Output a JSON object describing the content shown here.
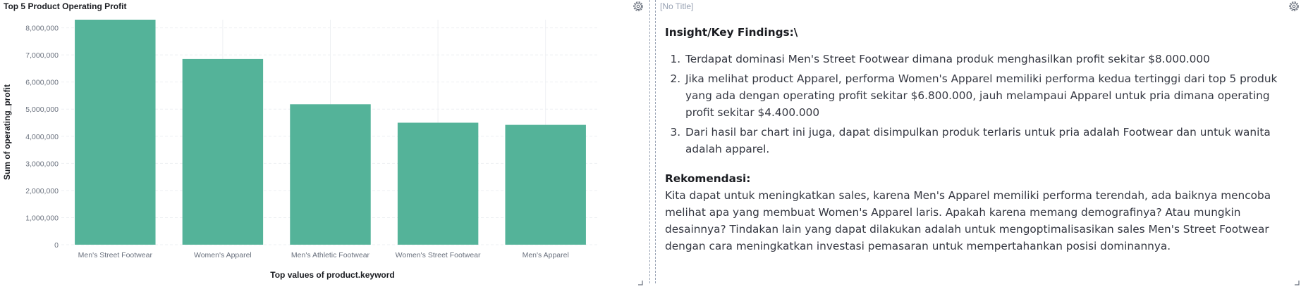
{
  "left_panel": {
    "title": "Top 5 Product Operating Profit"
  },
  "right_panel": {
    "title": "[No Title]",
    "heading": "Insight/Key Findings:\\",
    "findings": [
      "Terdapat dominasi Men's Street Footwear dimana produk menghasilkan profit sekitar $8.000.000",
      "Jika melihat product Apparel, performa Women's Apparel memiliki performa kedua tertinggi dari top 5 produk yang ada dengan operating profit sekitar $6.800.000, jauh melampaui Apparel untuk pria dimana operating profit sekitar $4.400.000",
      "Dari hasil bar chart ini juga, dapat disimpulkan produk terlaris untuk pria adalah Footwear dan untuk wanita adalah apparel."
    ],
    "recommendation_title": "Rekomendasi:",
    "recommendation_text": "Kita dapat untuk meningkatkan sales, karena Men's Apparel memiliki performa terendah, ada baiknya mencoba melihat apa yang membuat Women's Apparel laris. Apakah karena memang demografinya? Atau mungkin desainnya? Tindakan lain yang dapat dilakukan adalah untuk mengoptimalisasikan sales Men's Street Footwear dengan cara meningkatkan investasi pemasaran untuk mempertahankan posisi dominannya."
  },
  "icons": {
    "panel_options": "gear-icon",
    "resize": "resize-handle-icon"
  },
  "colors": {
    "bar": "#54b399",
    "grid": "#eef0f3",
    "axis_text": "#69707d",
    "title": "#1a1c21",
    "divider": "#98a2b3"
  },
  "chart_data": {
    "type": "bar",
    "title": "",
    "xlabel": "Top values of product.keyword",
    "ylabel": "Sum of operating_profit",
    "categories": [
      "Men's Street Footwear",
      "Women's Apparel",
      "Men's Athletic Footwear",
      "Women's Street Footwear",
      "Men's Apparel"
    ],
    "values": [
      8300000,
      6850000,
      5180000,
      4500000,
      4420000
    ],
    "ylim": [
      0,
      8300000
    ],
    "yticks": [
      0,
      1000000,
      2000000,
      3000000,
      4000000,
      5000000,
      6000000,
      7000000,
      8000000
    ],
    "ytick_labels": [
      "0",
      "1,000,000",
      "2,000,000",
      "3,000,000",
      "4,000,000",
      "5,000,000",
      "6,000,000",
      "7,000,000",
      "8,000,000"
    ],
    "grid": true,
    "legend": "none"
  }
}
